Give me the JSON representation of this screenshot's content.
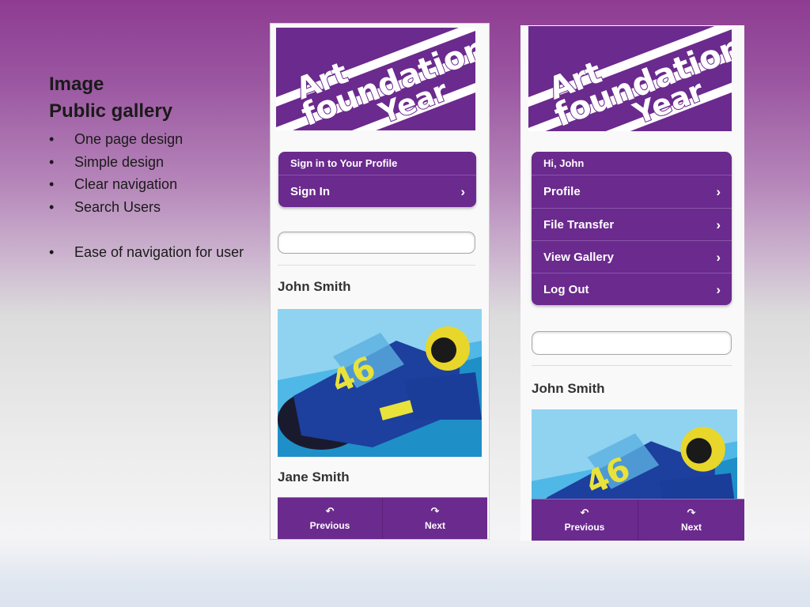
{
  "slide": {
    "heading_line1": "Image",
    "heading_line2": "Public gallery",
    "bullets": [
      "One page design",
      "Simple design",
      "Clear navigation",
      "Search Users",
      "Ease of navigation for user"
    ]
  },
  "logo": {
    "word1": "Art",
    "word2": "foundation",
    "word3": "Year"
  },
  "phone1": {
    "panel_header": "Sign in to Your Profile",
    "signin_label": "Sign In",
    "search_value": "",
    "user1_name": "John Smith",
    "user2_name": "Jane Smith",
    "prev_label": "Previous",
    "next_label": "Next"
  },
  "phone2": {
    "panel_header": "Hi, John",
    "menu": [
      "Profile",
      "File Transfer",
      "View Gallery",
      "Log Out"
    ],
    "search_value": "",
    "user1_name": "John Smith",
    "prev_label": "Previous",
    "next_label": "Next"
  },
  "icons": {
    "chevron": "chevron-right-icon",
    "previous": "undo-arrow-icon",
    "next": "redo-arrow-icon"
  },
  "colors": {
    "brand_purple": "#6b2a8e",
    "background_top": "#8e3c92",
    "background_bottom": "#ececec"
  }
}
